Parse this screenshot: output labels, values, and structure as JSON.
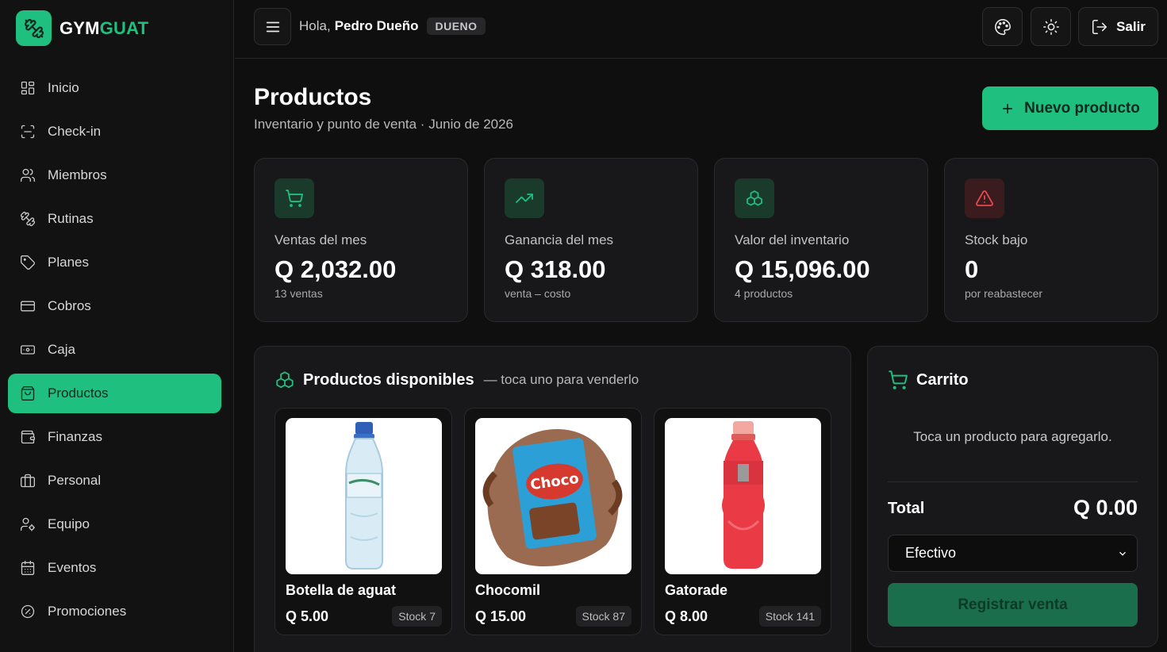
{
  "brand": {
    "part1": "GYM",
    "part2": "GUAT"
  },
  "sidebar": {
    "items": [
      {
        "label": "Inicio",
        "icon": "grid-icon"
      },
      {
        "label": "Check-in",
        "icon": "scan-icon"
      },
      {
        "label": "Miembros",
        "icon": "users-icon"
      },
      {
        "label": "Rutinas",
        "icon": "dumbbell-icon"
      },
      {
        "label": "Planes",
        "icon": "tag-icon"
      },
      {
        "label": "Cobros",
        "icon": "credit-card-icon"
      },
      {
        "label": "Caja",
        "icon": "cash-icon"
      },
      {
        "label": "Productos",
        "icon": "shopping-bag-icon",
        "active": true
      },
      {
        "label": "Finanzas",
        "icon": "wallet-icon"
      },
      {
        "label": "Personal",
        "icon": "briefcase-icon"
      },
      {
        "label": "Equipo",
        "icon": "user-cog-icon"
      },
      {
        "label": "Eventos",
        "icon": "calendar-icon"
      },
      {
        "label": "Promociones",
        "icon": "badge-percent-icon"
      }
    ]
  },
  "header": {
    "greeting": "Hola,",
    "user_name": "Pedro Dueño",
    "role": "DUENO",
    "logout_label": "Salir"
  },
  "page": {
    "title": "Productos",
    "subtitle": "Inventario y punto de venta · Junio de 2026",
    "new_button": "Nuevo producto"
  },
  "stats": [
    {
      "label": "Ventas del mes",
      "value": "Q 2,032.00",
      "sub": "13 ventas",
      "icon": "cart-icon",
      "color": "#1fbf7f"
    },
    {
      "label": "Ganancia del mes",
      "value": "Q 318.00",
      "sub": "venta – costo",
      "icon": "trending-up-icon",
      "color": "#1fbf7f"
    },
    {
      "label": "Valor del inventario",
      "value": "Q 15,096.00",
      "sub": "4 productos",
      "icon": "boxes-icon",
      "color": "#1fbf7f"
    },
    {
      "label": "Stock bajo",
      "value": "0",
      "sub": "por reabastecer",
      "icon": "alert-triangle-icon",
      "color": "#e5484d"
    }
  ],
  "products_panel": {
    "title": "Productos disponibles",
    "hint": "— toca uno para venderlo",
    "items": [
      {
        "name": "Botella de aguat",
        "price": "Q 5.00",
        "stock": "Stock 7"
      },
      {
        "name": "Chocomil",
        "price": "Q 15.00",
        "stock": "Stock 87"
      },
      {
        "name": "Gatorade",
        "price": "Q 8.00",
        "stock": "Stock 141"
      }
    ]
  },
  "cart": {
    "title": "Carrito",
    "empty": "Toca un producto para agregarlo.",
    "total_label": "Total",
    "total_value": "Q 0.00",
    "payment_method": "Efectivo",
    "register_button": "Registrar venta"
  },
  "colors": {
    "accent": "#1fbf7f",
    "danger": "#e5484d",
    "background": "#0f0f10",
    "card": "#18181a"
  }
}
